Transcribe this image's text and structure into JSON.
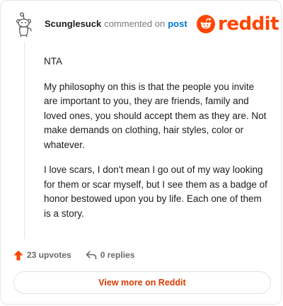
{
  "header": {
    "username": "Scunglesuck",
    "commented_text": "commented on",
    "post_link": "post",
    "brand": "reddit"
  },
  "comment": {
    "paragraphs": [
      "NTA",
      "My philosophy on this is that the people you invite are important to you, they are friends, family and loved ones, you should accept them as they are. Not make demands on clothing, hair styles, color or whatever.",
      "I love scars, I don't mean I go out of my way looking for them or scar myself, but I see them as a badge of honor bestowed upon you by life. Each one of them is a story."
    ]
  },
  "actions": {
    "upvotes_label": "23 upvotes",
    "replies_label": "0 replies"
  },
  "footer": {
    "view_more_label": "View more on Reddit"
  },
  "colors": {
    "brand": "#ff4500",
    "link": "#0079d3",
    "button_text": "#d93a00"
  },
  "icons": {
    "avatar": "snoo-avatar-icon",
    "logo": "reddit-logo-icon",
    "upvote": "upvote-arrow-icon",
    "reply": "reply-arrow-icon"
  }
}
